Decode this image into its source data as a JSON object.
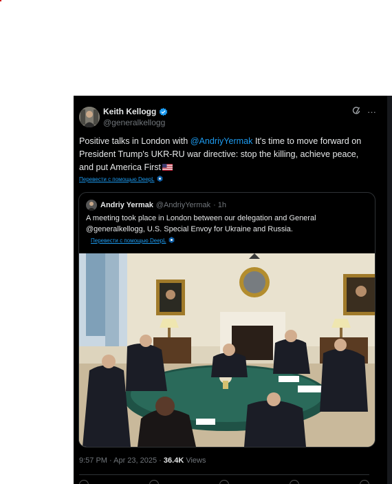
{
  "tweet": {
    "author_name": "Keith Kellogg",
    "author_handle": "@generalkellogg",
    "text_before_mention": "Positive talks in London with ",
    "mention": "@AndriyYermak",
    "text_after_mention": " It's time to move forward on President Trump's UKR-RU war directive: stop the killing, achieve peace, and put America First",
    "flag_icon": "us-flag-icon",
    "translate_label": "Перевести с помощью DeepL",
    "timestamp": "9:57 PM · Apr 23, 2025 · ",
    "views_count": "36.4K",
    "views_label": " Views"
  },
  "quote": {
    "author_name": "Andriy Yermak",
    "author_handle": "@AndriyYermak",
    "time": "· 1h",
    "text": "A meeting took place in London between our delegation and General @generalkellogg, U.S. Special Envoy for Ukraine and Russia.",
    "translate_label": "Перевести с помощью DeepL"
  },
  "colors": {
    "accent": "#1d9bf0",
    "background": "#000000",
    "text": "#e7e9ea",
    "muted": "#71767b"
  },
  "icons": [
    "verified-badge-icon",
    "grok-icon",
    "more-icon",
    "deepl-icon"
  ]
}
